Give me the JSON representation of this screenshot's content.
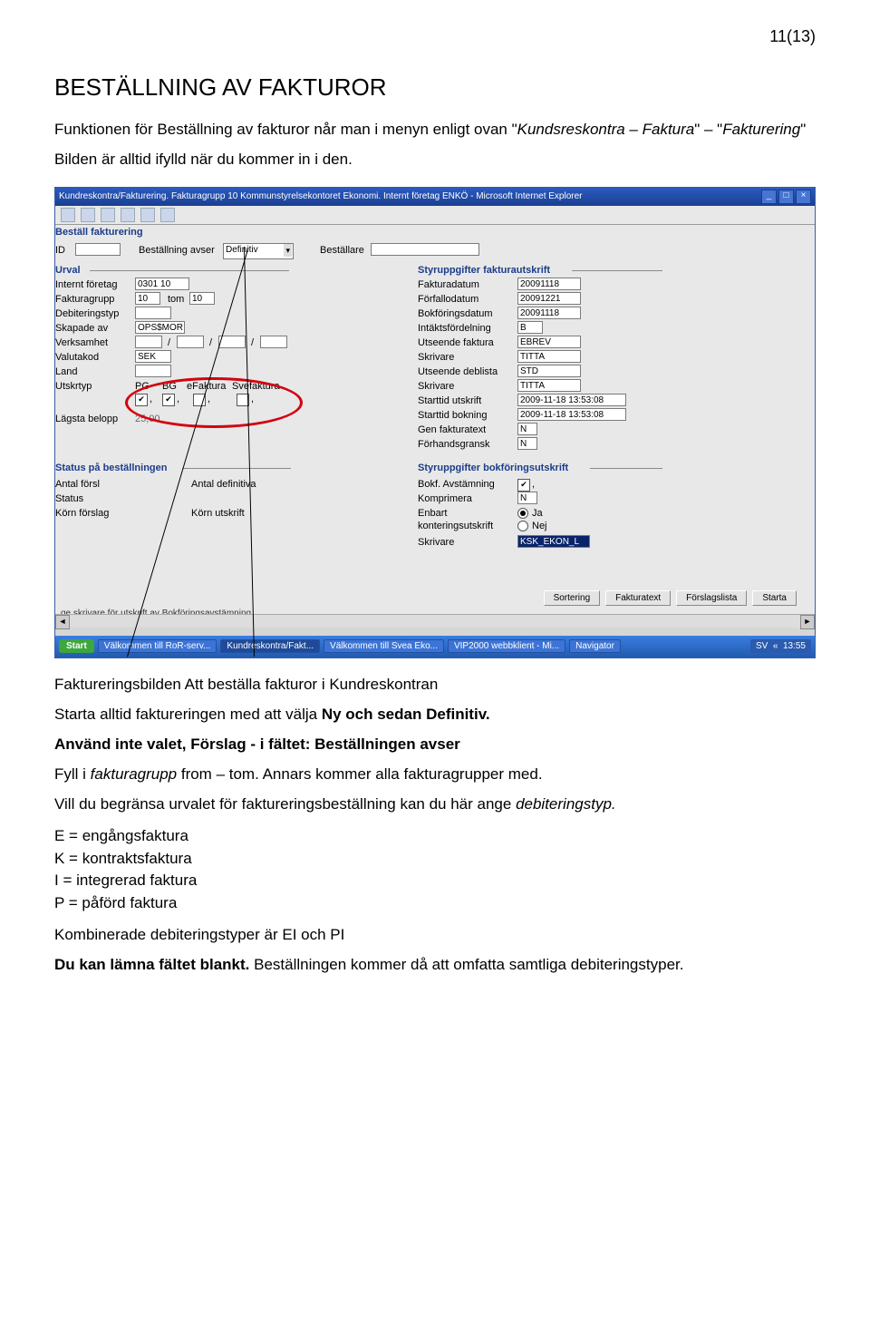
{
  "page_number": "11(13)",
  "heading": "BESTÄLLNING AV FAKTUROR",
  "intro_a": "Funktionen för Beställning av fakturor når man i menyn enligt ovan  \"",
  "intro_b": "Kundsreskontra – Faktura",
  "intro_c": "\" – \"",
  "intro_d": "Fakturering",
  "intro_e": "\"",
  "intro2": "Bilden är alltid ifylld när du kommer in i den.",
  "after1a": "Faktureringsbilden Att beställa fakturor i Kundreskontran",
  "after1b_a": "Starta alltid faktureringen med att välja ",
  "after1b_b": "Ny och sedan Definitiv.",
  "after2": "Använd inte valet, Förslag - i fältet:  Beställningen avser",
  "after3_a": "Fyll i ",
  "after3_b": "fakturagrupp",
  "after3_c": " from – tom. Annars kommer alla fakturagrupper med.",
  "after4_a": "Vill du begränsa urvalet för faktureringsbeställning kan du här ange ",
  "after4_b": "debiteringstyp.",
  "legend": [
    "E = engångsfaktura",
    "K = kontraktsfaktura",
    "I = integrerad faktura",
    "P = påförd faktura"
  ],
  "after5": "Kombinerade debiteringstyper är EI och PI",
  "after6_a": "Du kan lämna fältet blankt.",
  "after6_b": " Beställningen kommer då att omfatta samtliga debiteringstyper.",
  "app": {
    "title": "Kundreskontra/Fakturering. Fakturagrupp 10 Kommunstyrelsekontoret Ekonomi. Internt företag ENKÖ - Microsoft Internet Explorer",
    "section_bestall": "Beställ fakturering",
    "id_label": "ID",
    "best_avser_label": "Beställning avser",
    "best_avser_value": "Definitiv",
    "bestallare_label": "Beställare",
    "urval_title": "Urval",
    "fields_left": {
      "internt_foretag": {
        "label": "Internt företag",
        "value": "0301 10"
      },
      "fakturagrupp": {
        "label": "Fakturagrupp",
        "value": "10",
        "tom_label": "tom",
        "tom_value": "10"
      },
      "debiteringstyp": {
        "label": "Debiteringstyp",
        "value": ""
      },
      "skapade_av": {
        "label": "Skapade av",
        "value": "OPS$MOR"
      },
      "verksamhet": {
        "label": "Verksamhet",
        "value": ""
      },
      "valutakod": {
        "label": "Valutakod",
        "value": "SEK"
      },
      "land": {
        "label": "Land",
        "value": ""
      },
      "utskrtyp": {
        "label": "Utskrtyp",
        "pg": "PG",
        "bg": "BG",
        "efaktura": "eFaktura",
        "svefaktura": "Svefaktura"
      },
      "lagsta_belopp": {
        "label": "Lägsta belopp",
        "value": "25,00"
      }
    },
    "styr_fakt_title": "Styruppgifter fakturautskrift",
    "fields_right": {
      "fakturadatum": {
        "label": "Fakturadatum",
        "value": "20091118"
      },
      "forfallodatum": {
        "label": "Förfallodatum",
        "value": "20091221"
      },
      "bokforingsdatum": {
        "label": "Bokföringsdatum",
        "value": "20091118"
      },
      "intaktsfordelning": {
        "label": "Intäktsfördelning",
        "value": "B"
      },
      "utseende_faktura": {
        "label": "Utseende faktura",
        "value": "EBREV"
      },
      "skrivare1": {
        "label": "Skrivare",
        "value": "TITTA"
      },
      "utseende_deblista": {
        "label": "Utseende deblista",
        "value": "STD"
      },
      "skrivare2": {
        "label": "Skrivare",
        "value": "TITTA"
      },
      "starttid_utskrift": {
        "label": "Starttid utskrift",
        "value": "2009-11-18 13:53:08"
      },
      "starttid_bokning": {
        "label": "Starttid bokning",
        "value": "2009-11-18 13:53:08"
      },
      "gen_fakturatext": {
        "label": "Gen fakturatext",
        "value": "N"
      },
      "forhandsgransk": {
        "label": "Förhandsgransk",
        "value": "N"
      }
    },
    "status_title": "Status på beställningen",
    "status_fields": {
      "antal_forsl": "Antal försl",
      "antal_def": "Antal definitiva",
      "status": "Status",
      "korn_forslag": "Körn förslag",
      "korn_utskrift": "Körn utskrift"
    },
    "styr_bokf_title": "Styruppgifter bokföringsutskrift",
    "bokf_fields": {
      "avstamning": "Bokf. Avstämning",
      "komprimera": {
        "label": "Komprimera",
        "value": "N"
      },
      "enbart": "Enbart",
      "konteringsutskrift": "konteringsutskrift",
      "ja": "Ja",
      "nej": "Nej",
      "skrivare": {
        "label": "Skrivare",
        "value": "KSK_EKON_L"
      }
    },
    "buttons": [
      "Sortering",
      "Fakturatext",
      "Förslagslista",
      "Starta"
    ],
    "statusbar": "ge skrivare för utskrift av Bokföringsavstämning",
    "taskbar": {
      "start": "Start",
      "items": [
        "Välkommen till RoR-serv...",
        "Kundreskontra/Fakt...",
        "Välkommen till Svea Eko...",
        "VIP2000 webbklient - Mi...",
        "Navigator"
      ],
      "lang": "SV",
      "clock": "13:55"
    }
  }
}
